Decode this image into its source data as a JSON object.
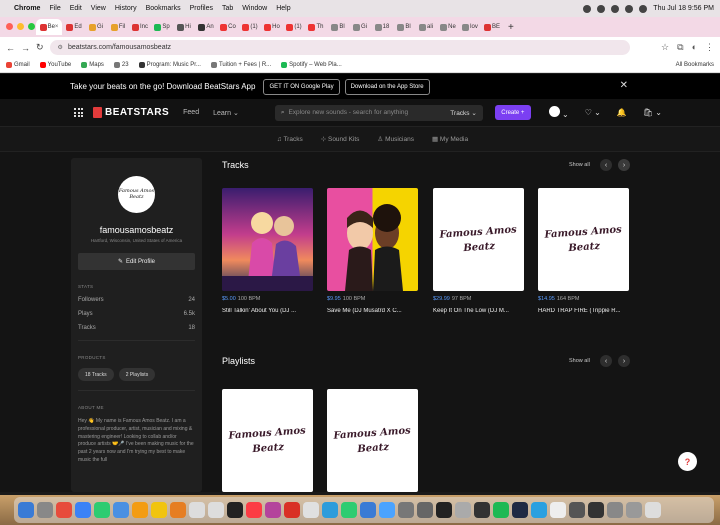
{
  "menubar": {
    "app": "Chrome",
    "items": [
      "File",
      "Edit",
      "View",
      "History",
      "Bookmarks",
      "Profiles",
      "Tab",
      "Window",
      "Help"
    ],
    "datetime": "Thu Jul 18  9:56 PM"
  },
  "tabs": [
    {
      "label": "Be",
      "color": "#d33"
    },
    {
      "label": "Ed",
      "color": "#d33"
    },
    {
      "label": "Gi",
      "color": "#e7a12b"
    },
    {
      "label": "Fil",
      "color": "#e7a12b"
    },
    {
      "label": "Inc",
      "color": "#d33"
    },
    {
      "label": "Sp",
      "color": "#1db954"
    },
    {
      "label": "Hi",
      "color": "#555"
    },
    {
      "label": "An",
      "color": "#333"
    },
    {
      "label": "Co",
      "color": "#e33"
    },
    {
      "label": "(1)",
      "color": "#e33"
    },
    {
      "label": "Ho",
      "color": "#e33"
    },
    {
      "label": "(1)",
      "color": "#e33"
    },
    {
      "label": "Th",
      "color": "#e33"
    },
    {
      "label": "Bl",
      "color": "#888"
    },
    {
      "label": "Gi",
      "color": "#888"
    },
    {
      "label": "18",
      "color": "#888"
    },
    {
      "label": "Bl",
      "color": "#888"
    },
    {
      "label": "ali",
      "color": "#888"
    },
    {
      "label": "Ne",
      "color": "#888"
    },
    {
      "label": "lov",
      "color": "#888"
    },
    {
      "label": "BE",
      "color": "#d33"
    }
  ],
  "address": {
    "url": "beatstars.com/famousamosbeatz"
  },
  "bookmarks": [
    {
      "label": "Gmail",
      "color": "#ea4335"
    },
    {
      "label": "YouTube",
      "color": "#ff0000"
    },
    {
      "label": "Maps",
      "color": "#34a853"
    },
    {
      "label": "23",
      "color": "#777"
    },
    {
      "label": "Program: Music Pr...",
      "color": "#333"
    },
    {
      "label": "Tuition + Fees | R...",
      "color": "#777"
    },
    {
      "label": "Spotify – Web Pla...",
      "color": "#1db954"
    }
  ],
  "all_bookmarks": "All Bookmarks",
  "promo": {
    "text": "Take your beats on the go! Download BeatStars App",
    "google_play": "GET IT ON Google Play",
    "app_store": "Download on the App Store"
  },
  "header": {
    "brand": "BEATSTARS",
    "feed": "Feed",
    "learn": "Learn",
    "search_placeholder": "Explore new sounds - search for anything",
    "search_category": "Tracks",
    "create": "Create"
  },
  "subnav": [
    "Tracks",
    "Sound Kits",
    "Musicians",
    "My Media"
  ],
  "profile": {
    "avatar_text": "Famous Amos Beatz",
    "name": "famousamosbeatz",
    "location": "Hartford, Wisconsin, United States of America",
    "edit": "Edit Profile",
    "stats_label": "STATS",
    "stats": [
      {
        "label": "Followers",
        "value": "24"
      },
      {
        "label": "Plays",
        "value": "6.5k"
      },
      {
        "label": "Tracks",
        "value": "18"
      }
    ],
    "products_label": "PRODUCTS",
    "products": [
      "18 Tracks",
      "2 Playlists"
    ],
    "about_label": "ABOUT ME",
    "about": "Hey 👋 My name is Famous Amos Beatz. I am a professional producer, artist, musician and mixing & mastering engineer! Looking to collab and/or produce artists 🤝🎤 I've been making music for the past 2 years now and I'm trying my best to make music the full"
  },
  "tracks_section": {
    "title": "Tracks",
    "show_all": "Show all",
    "items": [
      {
        "price": "$5.00",
        "bpm": "100 BPM",
        "title": "Still Talkin' About You (DJ ...",
        "cover": "synthwave"
      },
      {
        "price": "$9.95",
        "bpm": "100 BPM",
        "title": "Save Me (DJ Musatrd X C...",
        "cover": "popart"
      },
      {
        "price": "$29.99",
        "bpm": "97 BPM",
        "title": "Keep It On The Low (DJ M...",
        "cover": "famous"
      },
      {
        "price": "$14.95",
        "bpm": "164 BPM",
        "title": "HARD TRAP FIRE (Trippie R...",
        "cover": "famous"
      }
    ]
  },
  "playlists_section": {
    "title": "Playlists",
    "show_all": "Show all",
    "items": [
      {
        "cover": "famous"
      },
      {
        "cover": "famous"
      }
    ]
  },
  "cover_text_line1": "Famous Amos",
  "cover_text_line2": "Beatz",
  "help": "?",
  "dock_colors": [
    "#3a7bd5",
    "#888",
    "#e74c3c",
    "#3b82f6",
    "#2ecc71",
    "#4a90e2",
    "#f39c12",
    "#f1c40f",
    "#e67e22",
    "#ddd",
    "#ddd",
    "#222",
    "#fc3c44",
    "#b4449c",
    "#d93025",
    "#e0e0e0",
    "#2d9cdb",
    "#2ecc71",
    "#3a7bd5",
    "#4aa3ff",
    "#777",
    "#666",
    "#222",
    "#aaa",
    "#333",
    "#1db954",
    "#1f2a44",
    "#2aa0e0",
    "#eee",
    "#555",
    "#333",
    "#888",
    "#999",
    "#ddd"
  ]
}
